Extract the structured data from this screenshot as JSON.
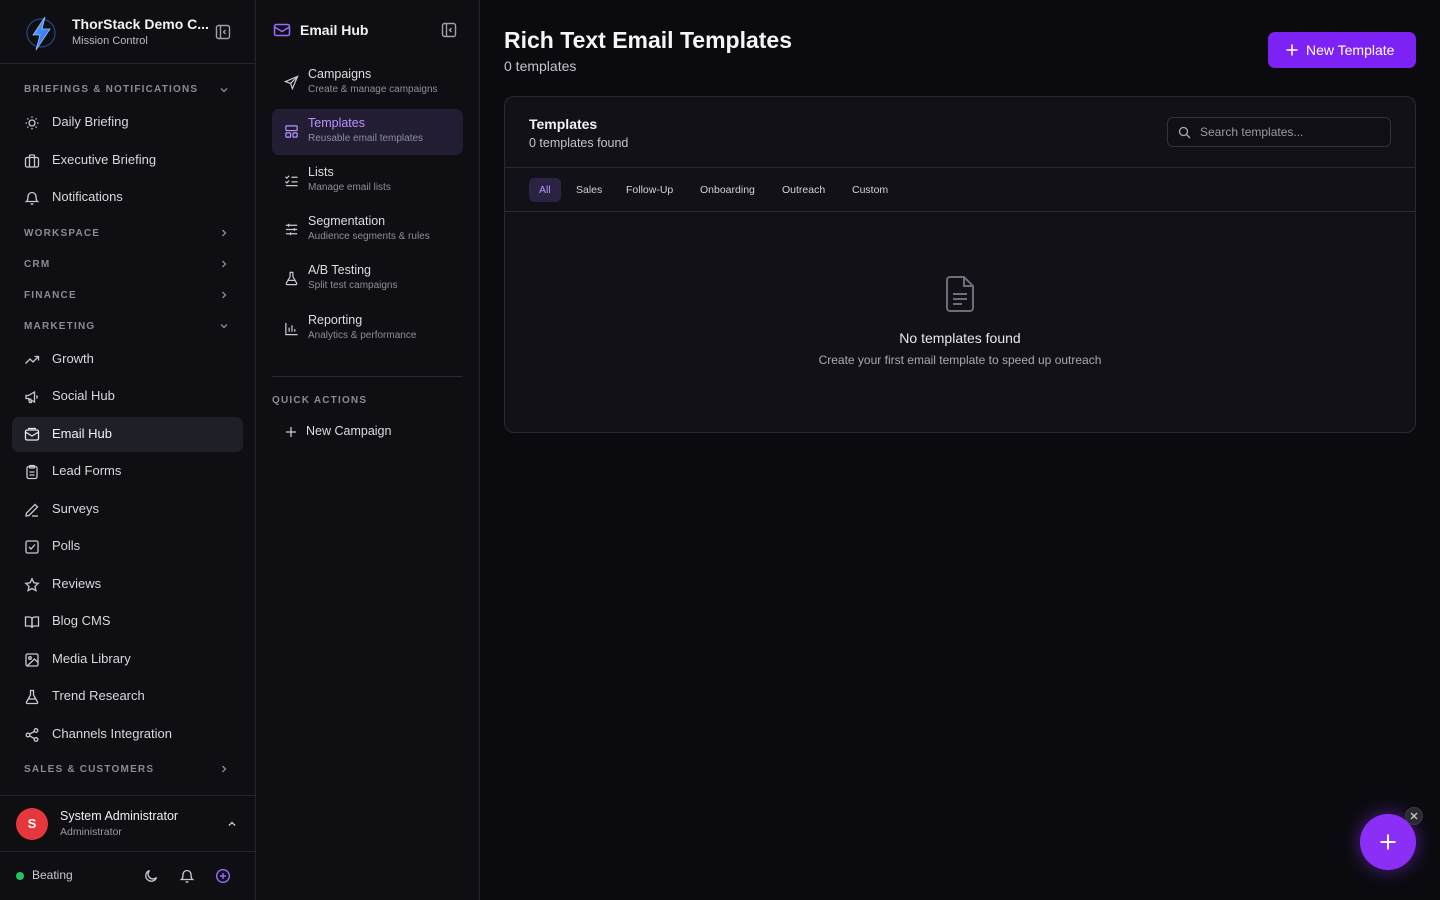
{
  "brand": {
    "name": "ThorStack Demo C...",
    "subtitle": "Mission Control"
  },
  "sidebar": {
    "sections": [
      {
        "label": "BRIEFINGS & NOTIFICATIONS",
        "expanded": true
      },
      {
        "label": "WORKSPACE",
        "expanded": false
      },
      {
        "label": "CRM",
        "expanded": false
      },
      {
        "label": "FINANCE",
        "expanded": false
      },
      {
        "label": "MARKETING",
        "expanded": true
      },
      {
        "label": "SALES & CUSTOMERS",
        "expanded": false
      }
    ],
    "items": [
      {
        "label": "Daily Briefing",
        "icon": "sun-icon"
      },
      {
        "label": "Executive Briefing",
        "icon": "briefcase-icon"
      },
      {
        "label": "Notifications",
        "icon": "bell-icon"
      },
      {
        "label": "Growth",
        "icon": "trending-up-icon"
      },
      {
        "label": "Social Hub",
        "icon": "megaphone-icon"
      },
      {
        "label": "Email Hub",
        "icon": "mail-icon",
        "active": true
      },
      {
        "label": "Lead Forms",
        "icon": "clipboard-icon"
      },
      {
        "label": "Surveys",
        "icon": "pen-icon"
      },
      {
        "label": "Polls",
        "icon": "check-square-icon"
      },
      {
        "label": "Reviews",
        "icon": "star-icon"
      },
      {
        "label": "Blog CMS",
        "icon": "book-icon"
      },
      {
        "label": "Media Library",
        "icon": "image-icon"
      },
      {
        "label": "Trend Research",
        "icon": "flask-icon"
      },
      {
        "label": "Channels Integration",
        "icon": "share-icon"
      }
    ]
  },
  "user": {
    "initial": "S",
    "name": "System Administrator",
    "role": "Administrator"
  },
  "footer": {
    "status": "Beating"
  },
  "subnav": {
    "title": "Email Hub",
    "items": [
      {
        "label": "Campaigns",
        "desc": "Create & manage campaigns",
        "icon": "send-icon"
      },
      {
        "label": "Templates",
        "desc": "Reusable email templates",
        "icon": "layout-template-icon",
        "active": true
      },
      {
        "label": "Lists",
        "desc": "Manage email lists",
        "icon": "list-checks-icon"
      },
      {
        "label": "Segmentation",
        "desc": "Audience segments & rules",
        "icon": "sliders-icon"
      },
      {
        "label": "A/B Testing",
        "desc": "Split test campaigns",
        "icon": "flask-icon"
      },
      {
        "label": "Reporting",
        "desc": "Analytics & performance",
        "icon": "bar-chart-icon"
      }
    ],
    "quick_actions_title": "QUICK ACTIONS",
    "quick_actions": [
      {
        "label": "New Campaign"
      }
    ]
  },
  "main": {
    "title": "Rich Text Email Templates",
    "subtitle": "0 templates",
    "new_button": "New Template",
    "card": {
      "title": "Templates",
      "subtitle": "0 templates found",
      "search_placeholder": "Search templates...",
      "tabs": [
        "All",
        "Sales",
        "Follow-Up",
        "Onboarding",
        "Outreach",
        "Custom"
      ],
      "active_tab": "All",
      "empty_title": "No templates found",
      "empty_subtitle": "Create your first email template to speed up outreach"
    }
  },
  "colors": {
    "accent": "#7c22f5",
    "accent_text": "#b993ff",
    "status_green": "#22c55e",
    "avatar_red": "#e5373c"
  }
}
